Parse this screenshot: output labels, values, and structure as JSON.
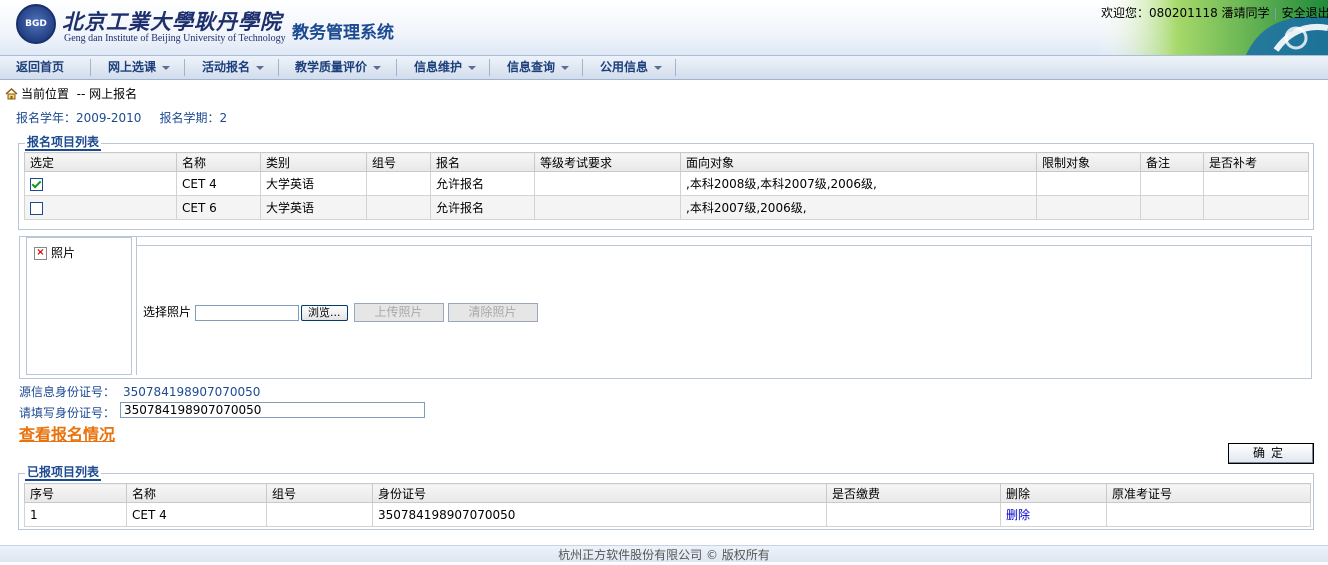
{
  "header": {
    "logo_text": "BGD",
    "school_name_cn": "北京工業大學耿丹學院",
    "school_name_en": "Geng dan Institute of Beijing University of Technology",
    "system_title": "教务管理系统",
    "welcome": "欢迎您：080201118 潘靖同学",
    "logout": "安全退出"
  },
  "menu": [
    {
      "label": "返回首页",
      "dropdown": false
    },
    {
      "label": "网上选课",
      "dropdown": true
    },
    {
      "label": "活动报名",
      "dropdown": true
    },
    {
      "label": "教学质量评价",
      "dropdown": true
    },
    {
      "label": "信息维护",
      "dropdown": true
    },
    {
      "label": "信息查询",
      "dropdown": true
    },
    {
      "label": "公用信息",
      "dropdown": true
    }
  ],
  "location": {
    "label": "当前位置",
    "path": "-- 网上报名"
  },
  "term": {
    "year_label": "报名学年：",
    "year": "2009-2010",
    "sem_label": "报名学期：",
    "sem": "2"
  },
  "projects": {
    "legend": "报名项目列表",
    "columns": [
      "选定",
      "名称",
      "类别",
      "组号",
      "报名",
      "等级考试要求",
      "面向对象",
      "限制对象",
      "备注",
      "是否补考"
    ],
    "rows": [
      {
        "checked": true,
        "name": "CET 4",
        "category": "大学英语",
        "group": "",
        "signup": "允许报名",
        "req": "",
        "target": ",本科2008级,本科2007级,2006级,",
        "limit": "",
        "note": "",
        "retake": ""
      },
      {
        "checked": false,
        "name": "CET 6",
        "category": "大学英语",
        "group": "",
        "signup": "允许报名",
        "req": "",
        "target": ",本科2007级,2006级,",
        "limit": "",
        "note": "",
        "retake": ""
      }
    ]
  },
  "photo": {
    "alt": "照片",
    "choose_label": "选择照片",
    "browse": "浏览...",
    "upload": "上传照片",
    "clear": "清除照片"
  },
  "identity": {
    "source_label": "源信息身份证号：",
    "source_value": "350784198907070050",
    "fill_label": "请填写身份证号：",
    "fill_value": "350784198907070050"
  },
  "view_link": "查看报名情况",
  "confirm": "确定",
  "registered": {
    "legend": "已报项目列表",
    "columns": [
      "序号",
      "名称",
      "组号",
      "身份证号",
      "是否缴费",
      "删除",
      "原准考证号"
    ],
    "rows": [
      {
        "no": "1",
        "name": "CET 4",
        "group": "",
        "id": "350784198907070050",
        "paid": "",
        "delete": "删除",
        "old_ticket": ""
      }
    ]
  },
  "footer": "杭州正方软件股份有限公司 © 版权所有",
  "colors": {
    "accent": "#1c4a91",
    "link_orange": "#e8720c",
    "border": "#b8c6d8"
  }
}
